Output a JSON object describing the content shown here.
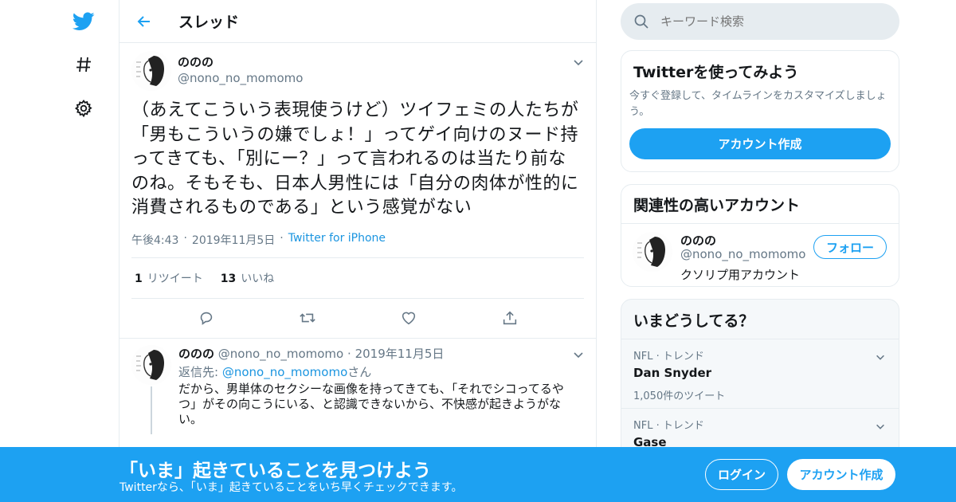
{
  "colors": {
    "accent": "#1da1f2",
    "link": "#1b95e0",
    "muted": "#657786",
    "border": "#e6ecf0"
  },
  "nav": {
    "icons": [
      "twitter-bird-icon",
      "hashtag-icon",
      "gear-icon"
    ]
  },
  "header": {
    "title": "スレッド"
  },
  "tweet": {
    "author_name": "ののの",
    "author_handle": "@nono_no_momomo",
    "text": "（あえてこういう表現使うけど）ツイフェミの人たちが「男もこういうの嫌でしょ！」ってゲイ向けのヌード持ってきても、「別にー？」って言われるのは当たり前なのね。そもそも、日本人男性には「自分の肉体が性的に消費されるものである」という感覚がない",
    "time": "午後4:43",
    "date": "2019年11月5日",
    "source": "Twitter for iPhone",
    "sep": "·",
    "retweet_count": "1",
    "retweet_label": "リツイート",
    "like_count": "13",
    "like_label": "いいね"
  },
  "reply": {
    "author_name": "ののの",
    "author_handle": "@nono_no_momomo",
    "date": "2019年11月5日",
    "sep": "·",
    "reply_to_prefix": "返信先:",
    "reply_to_handle": "@nono_no_momomo",
    "reply_to_suffix": "さん",
    "text": "だから、男単体のセクシーな画像を持ってきても、「それでシコってるやつ」がその向こうにいる、と認識できないから、不快感が起きようがない。"
  },
  "search": {
    "placeholder": "キーワード検索"
  },
  "signup_card": {
    "title": "Twitterを使ってみよう",
    "description": "今すぐ登録して、タイムラインをカスタマイズしましょう。",
    "button": "アカウント作成"
  },
  "related": {
    "title": "関連性の高いアカウント",
    "name": "ののの",
    "handle": "@nono_no_momomo",
    "bio": "クソリプ用アカウント",
    "follow": "フォロー"
  },
  "trends": {
    "title": "いまどうしてる？",
    "items": [
      {
        "meta": "NFL · トレンド",
        "name": "Dan Snyder",
        "count": "1,050件のツイート"
      },
      {
        "meta": "NFL · トレンド",
        "name": "Gase",
        "count": ""
      }
    ]
  },
  "banner": {
    "title": "「いま」起きていることを見つけよう",
    "subtitle": "Twitterなら、「いま」起きていることをいち早くチェックできます。",
    "login": "ログイン",
    "signup": "アカウント作成"
  }
}
